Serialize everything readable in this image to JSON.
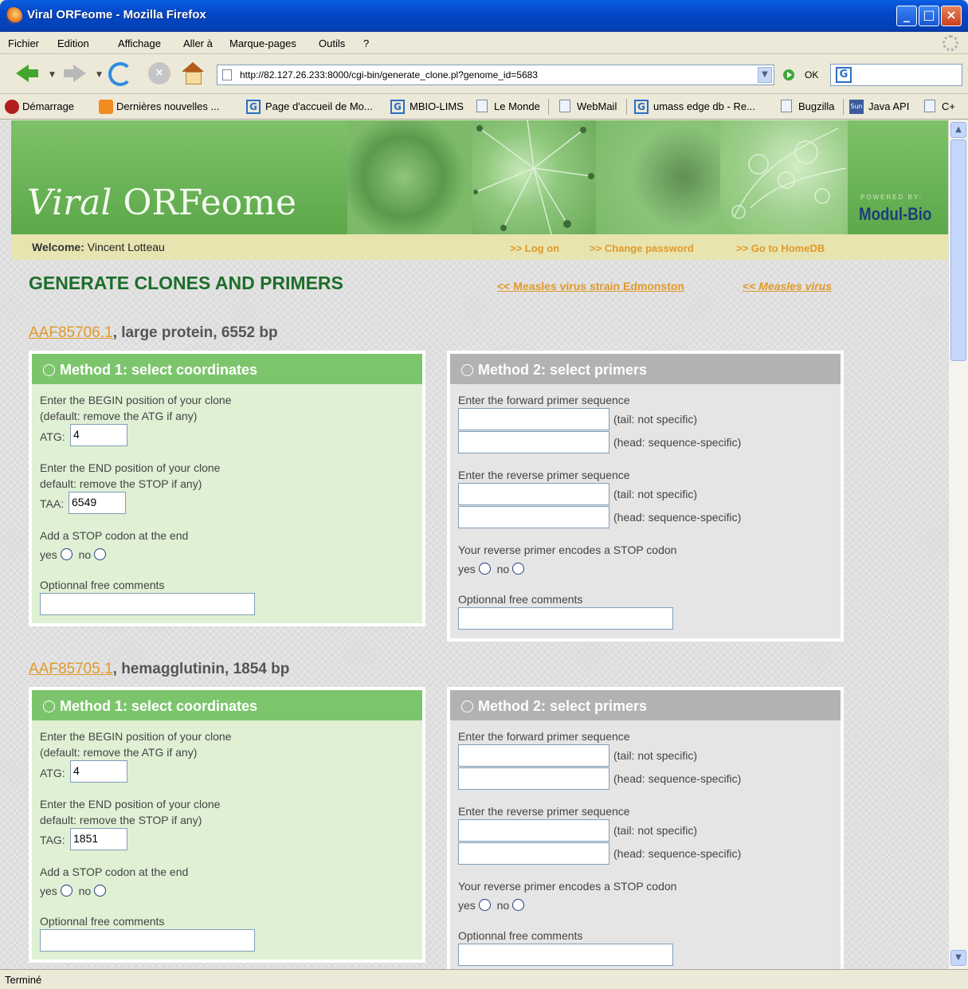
{
  "window": {
    "title": "Viral ORFeome - Mozilla Firefox"
  },
  "menu": [
    "Fichier",
    "Edition",
    "Affichage",
    "Aller à",
    "Marque-pages",
    "Outils",
    "?"
  ],
  "nav": {
    "url": "http://82.127.26.233:8000/cgi-bin/generate_clone.pl?genome_id=5683",
    "go_label": "OK"
  },
  "bookmarks": [
    "Démarrage",
    "Dernières nouvelles ...",
    "Page d'accueil de Mo...",
    "MBIO-LIMS",
    "Le Monde",
    "WebMail",
    "umass edge db - Re...",
    "Bugzilla",
    "Java API",
    "C+"
  ],
  "banner": {
    "logo_italic": "Viral",
    "logo_rest": " ORFeome",
    "powered": "POWERED BY:",
    "brand": "Modul-Bio"
  },
  "welcome": {
    "label": "Welcome:",
    "user": " Vincent Lotteau"
  },
  "links": {
    "log_on": ">> Log on",
    "change_password": ">> Change password",
    "go_home": ">> Go to HomeDB"
  },
  "page": {
    "title": "GENERATE CLONES AND PRIMERS",
    "crumb_strain": "<< Measles virus strain Edmonston",
    "crumb_virus": "<< Measles virus"
  },
  "common": {
    "method1": "Method 1: select coordinates",
    "method2": "Method 2: select primers",
    "begin_line1": "Enter the BEGIN position of your clone",
    "begin_line2": "(default: remove the ATG if any)",
    "end_line1": "Enter the END position of your clone",
    "end_line2": "default: remove the STOP if any)",
    "add_stop": "Add a STOP codon at the end",
    "yes": "yes",
    "no": "no",
    "comments": "Optionnal free comments",
    "fwd_primer": "Enter the forward primer sequence",
    "rev_primer": "Enter the reverse primer sequence",
    "tail": "(tail: not specific)",
    "head": "(head: sequence-specific)",
    "rev_stop": "Your reverse primer encodes a STOP codon"
  },
  "proteins": [
    {
      "accession": "AAF85706.1",
      "description": ", large protein, 6552 bp",
      "start_codon": "ATG:",
      "begin": "4",
      "stop_codon": "TAA:",
      "end": "6549"
    },
    {
      "accession": "AAF85705.1",
      "description": ", hemagglutinin, 1854 bp",
      "start_codon": "ATG:",
      "begin": "4",
      "stop_codon": "TAG:",
      "end": "1851"
    }
  ],
  "status": "Terminé"
}
